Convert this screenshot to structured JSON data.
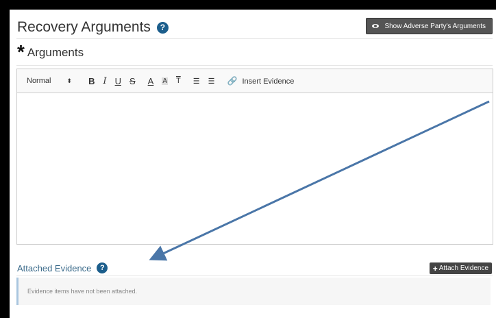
{
  "header": {
    "title": "Recovery Arguments",
    "help_glyph": "?",
    "show_button_label": "Show Adverse Party's Arguments"
  },
  "arguments": {
    "asterisk": "*",
    "label": "Arguments"
  },
  "toolbar": {
    "format_select": "Normal",
    "select_arrows": "⬍",
    "bold": "B",
    "italic": "I",
    "underline": "U",
    "strike": "S",
    "font_color": "A",
    "highlight": "A",
    "clear_format": "T",
    "ordered_list": "☰",
    "bullet_list": "☰",
    "insert_evidence_label": "Insert Evidence"
  },
  "evidence": {
    "label": "Attached Evidence",
    "help_glyph": "?",
    "attach_button_label": "Attach Evidence",
    "attach_plus": "+",
    "empty_message": "Evidence items have not been attached."
  },
  "colors": {
    "help_icon": "#1c5e8c",
    "arrow": "#4a76a8",
    "evidence_label": "#3a6a8a"
  }
}
